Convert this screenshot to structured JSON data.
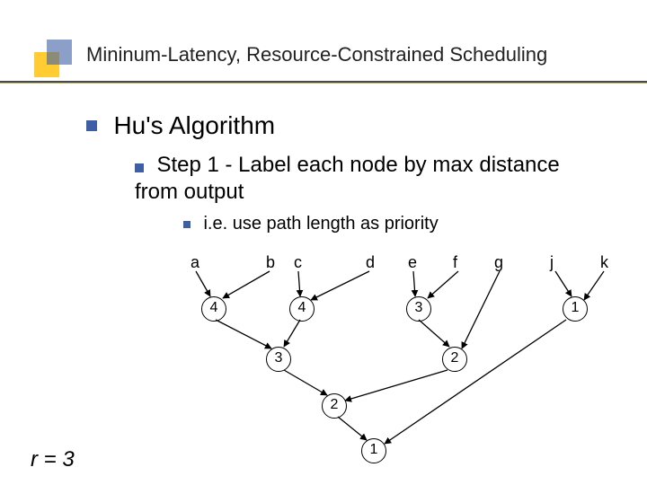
{
  "title": "Mininum-Latency, Resource-Constrained Scheduling",
  "l1": "Hu's Algorithm",
  "l2_a": "Step 1 - Label each node by max distance",
  "l2_b": "from output",
  "l3": "i.e. use path length as priority",
  "r_label": "r = 3",
  "diagram": {
    "inputs": {
      "a": "a",
      "b": "b",
      "c": "c",
      "d": "d",
      "e": "e",
      "f": "f",
      "g": "g",
      "j": "j",
      "k": "k"
    },
    "nodes": {
      "n1": "4",
      "n2": "4",
      "n3": "3",
      "n4": "3",
      "n5": "2",
      "n6": "2",
      "n7": "1",
      "n8": "1"
    }
  }
}
